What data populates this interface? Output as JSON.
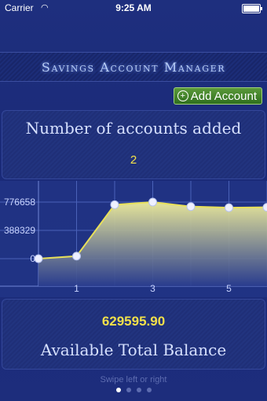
{
  "status_bar": {
    "carrier": "Carrier",
    "time": "9:25 AM"
  },
  "header": {
    "title": "Savings Account Manager"
  },
  "actions": {
    "add_account_label": "Add Account"
  },
  "accounts_panel": {
    "label": "Number of accounts added",
    "value": "2"
  },
  "balance_panel": {
    "value": "629595.90",
    "label": "Available Total Balance"
  },
  "footer": {
    "hint": "Swipe left or right",
    "page_count": 4,
    "current_page": 0
  },
  "colors": {
    "line": "#e8e05a",
    "value_text": "#f2e04a",
    "accent": "#2f6f1e"
  },
  "icons": {
    "add": "plus-circle-icon",
    "wifi": "wifi-icon",
    "battery": "battery-icon"
  },
  "chart_data": {
    "type": "area",
    "x": [
      0,
      1,
      2,
      3,
      4,
      5,
      6
    ],
    "values": [
      0,
      35000,
      740000,
      776658,
      715000,
      700000,
      705000
    ],
    "y_tick_labels": [
      "0",
      "388329",
      "776658"
    ],
    "y_ticks": [
      0,
      388329,
      776658
    ],
    "x_tick_labels": [
      "1",
      "3",
      "5"
    ],
    "x_ticks": [
      1,
      3,
      5
    ],
    "ylim": [
      0,
      776658
    ],
    "grid": true
  }
}
